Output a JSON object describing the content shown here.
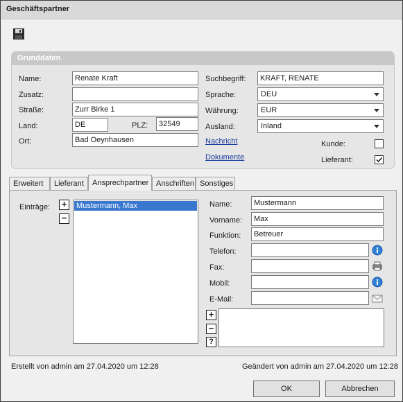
{
  "window": {
    "title": "Geschäftspartner"
  },
  "toolbar": {
    "save_icon": "floppy-disk-icon"
  },
  "grunddaten": {
    "header": "Grunddaten",
    "name_label": "Name:",
    "name_value": "Renate Kraft",
    "zusatz_label": "Zusatz:",
    "zusatz_value": "",
    "strasse_label": "Straße:",
    "strasse_value": "Zurr Birke 1",
    "land_label": "Land:",
    "land_value": "DE",
    "plz_label": "PLZ:",
    "plz_value": "32549",
    "ort_label": "Ort:",
    "ort_value": "Bad Oeynhausen",
    "suchbegriff_label": "Suchbegriff:",
    "suchbegriff_value": "KRAFT, RENATE",
    "sprache_label": "Sprache:",
    "sprache_value": "DEU",
    "waehrung_label": "Währung:",
    "waehrung_value": "EUR",
    "ausland_label": "Ausland:",
    "ausland_value": "Inland",
    "nachricht_link": "Nachricht",
    "dokumente_link": "Dokumente",
    "kunde_label": "Kunde:",
    "kunde_checked": false,
    "lieferant_label": "Lieferant:",
    "lieferant_checked": true
  },
  "tabs": [
    "Erweitert",
    "Lieferant",
    "Ansprechpartner",
    "Anschriften",
    "Sonstiges"
  ],
  "active_tab": "Ansprechpartner",
  "contact": {
    "eintraege_label": "Einträge:",
    "entries": [
      "Mustermann, Max"
    ],
    "add_button": "+",
    "remove_button": "−",
    "help_button": "?",
    "name_label": "Name:",
    "name_value": "Mustermann",
    "vorname_label": "Vorname:",
    "vorname_value": "Max",
    "funktion_label": "Funktion:",
    "funktion_value": "Betreuer",
    "telefon_label": "Telefon:",
    "telefon_value": "",
    "fax_label": "Fax:",
    "fax_value": "",
    "mobil_label": "Mobil:",
    "mobil_value": "",
    "email_label": "E-Mail:",
    "email_value": ""
  },
  "footer": {
    "created": "Erstellt von admin am 27.04.2020 um 12:28",
    "changed": "Geändert von admin am 27.04.2020 um 12:28"
  },
  "buttons": {
    "ok": "OK",
    "cancel": "Abbrechen"
  }
}
